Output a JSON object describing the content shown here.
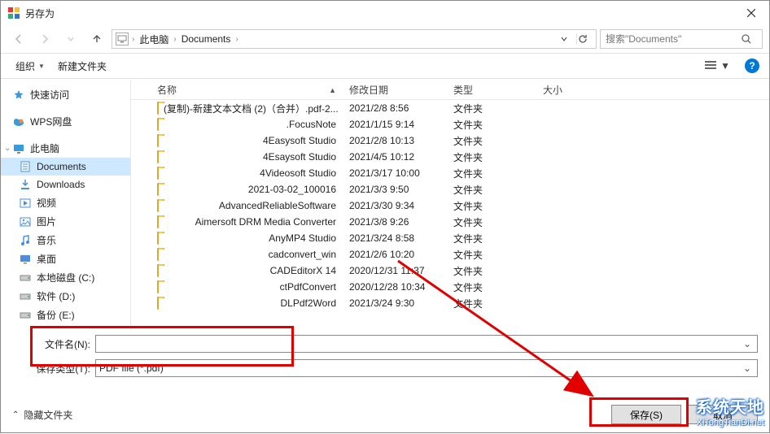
{
  "title": "另存为",
  "breadcrumbs": {
    "root": "此电脑",
    "folder": "Documents"
  },
  "search": {
    "placeholder": "搜索\"Documents\""
  },
  "toolbar": {
    "organize": "组织",
    "newfolder": "新建文件夹"
  },
  "sidebar": {
    "quick": "快速访问",
    "wps": "WPS网盘",
    "thispc": "此电脑",
    "items": [
      {
        "label": "Documents"
      },
      {
        "label": "Downloads"
      },
      {
        "label": "视频"
      },
      {
        "label": "图片"
      },
      {
        "label": "音乐"
      },
      {
        "label": "桌面"
      },
      {
        "label": "本地磁盘 (C:)"
      },
      {
        "label": "软件 (D:)"
      },
      {
        "label": "备份 (E:)"
      }
    ]
  },
  "columns": {
    "name": "名称",
    "date": "修改日期",
    "type": "类型",
    "size": "大小"
  },
  "type_folder": "文件夹",
  "rows": [
    {
      "name": "(复制)-新建文本文档 (2)（合并）.pdf-2...",
      "date": "2021/2/8 8:56"
    },
    {
      "name": ".FocusNote",
      "date": "2021/1/15 9:14"
    },
    {
      "name": "4Easysoft Studio",
      "date": "2021/2/8 10:13"
    },
    {
      "name": "4Esaysoft Studio",
      "date": "2021/4/5 10:12"
    },
    {
      "name": "4Videosoft Studio",
      "date": "2021/3/17 10:00"
    },
    {
      "name": "2021-03-02_100016",
      "date": "2021/3/3 9:50"
    },
    {
      "name": "AdvancedReliableSoftware",
      "date": "2021/3/30 9:34"
    },
    {
      "name": "Aimersoft DRM Media Converter",
      "date": "2021/3/8 9:26"
    },
    {
      "name": "AnyMP4 Studio",
      "date": "2021/3/24 8:58"
    },
    {
      "name": "cadconvert_win",
      "date": "2021/2/6 10:20"
    },
    {
      "name": "CADEditorX 14",
      "date": "2020/12/31 11:37"
    },
    {
      "name": "ctPdfConvert",
      "date": "2020/12/28 10:34"
    },
    {
      "name": "DLPdf2Word",
      "date": "2021/3/24 9:30"
    }
  ],
  "fields": {
    "filename_label": "文件名(N):",
    "filename_value": "",
    "filetype_label": "保存类型(T):",
    "filetype_value": "PDF file (*.pdf)"
  },
  "footer": {
    "hide": "隐藏文件夹",
    "save": "保存(S)",
    "cancel": "取消"
  },
  "watermark": {
    "l1": "系统天地",
    "l2": "XiTongTianDi.net"
  }
}
